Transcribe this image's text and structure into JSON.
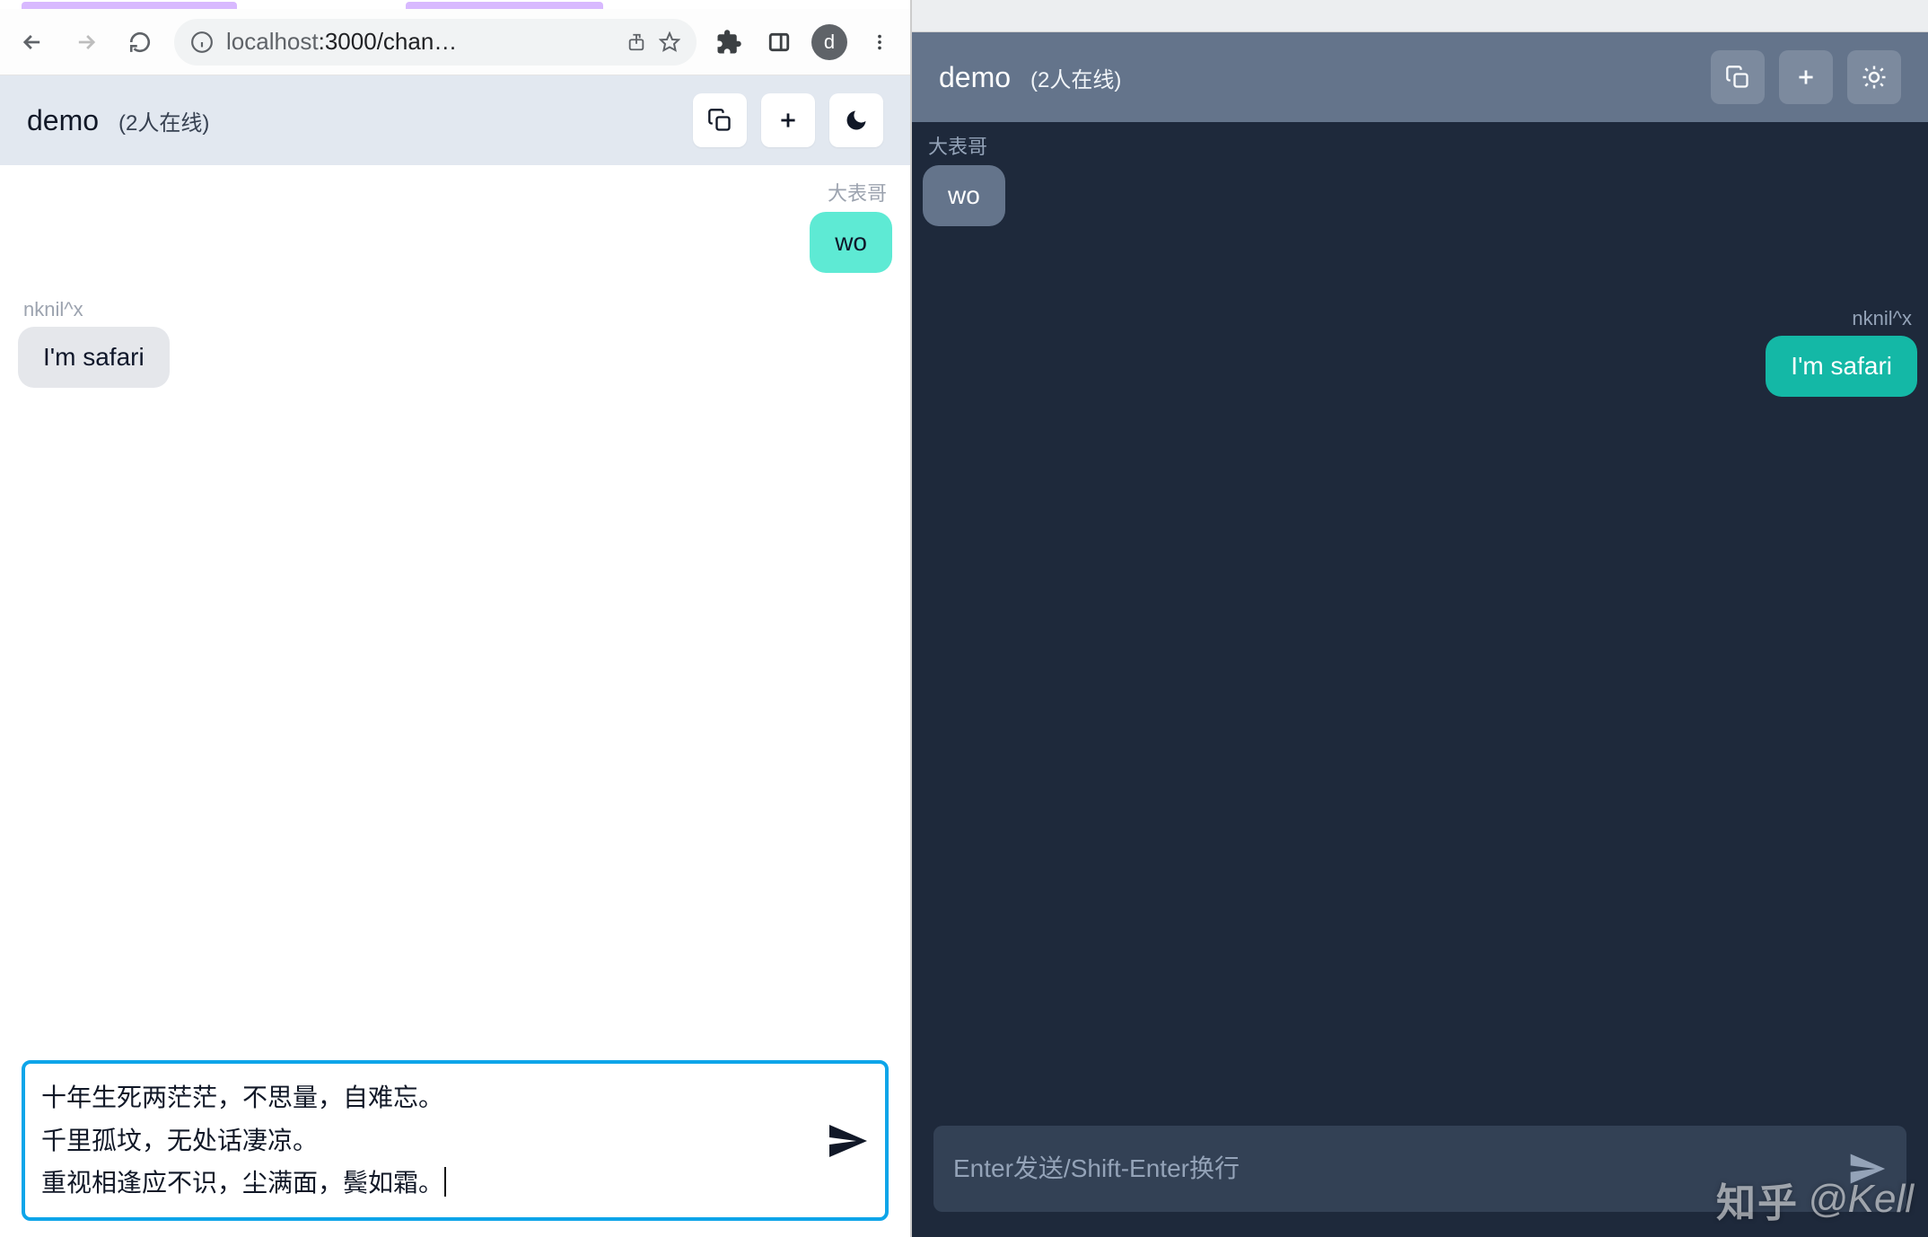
{
  "browser": {
    "address": {
      "prefix": "localhost",
      "rest": ":3000/chan…"
    },
    "avatar_letter": "d"
  },
  "left": {
    "header": {
      "room": "demo",
      "online": "(2人在线)"
    },
    "messages": [
      {
        "side": "right",
        "sender": "大表哥",
        "text": "wo"
      },
      {
        "side": "left",
        "sender": "nknil^x",
        "text": "I'm safari"
      }
    ],
    "composer_value": "十年生死两茫茫，不思量，自难忘。\n千里孤坟，无处话凄凉。\n重视相逢应不识，尘满面，鬓如霜。"
  },
  "right": {
    "header": {
      "room": "demo",
      "online": "(2人在线)"
    },
    "messages": [
      {
        "side": "left",
        "sender": "大表哥",
        "text": "wo"
      },
      {
        "side": "right",
        "sender": "nknil^x",
        "text": "I'm safari"
      }
    ],
    "composer_placeholder": "Enter发送/Shift-Enter换行"
  },
  "watermark": {
    "logo": "知乎",
    "handle": "@Kell"
  }
}
